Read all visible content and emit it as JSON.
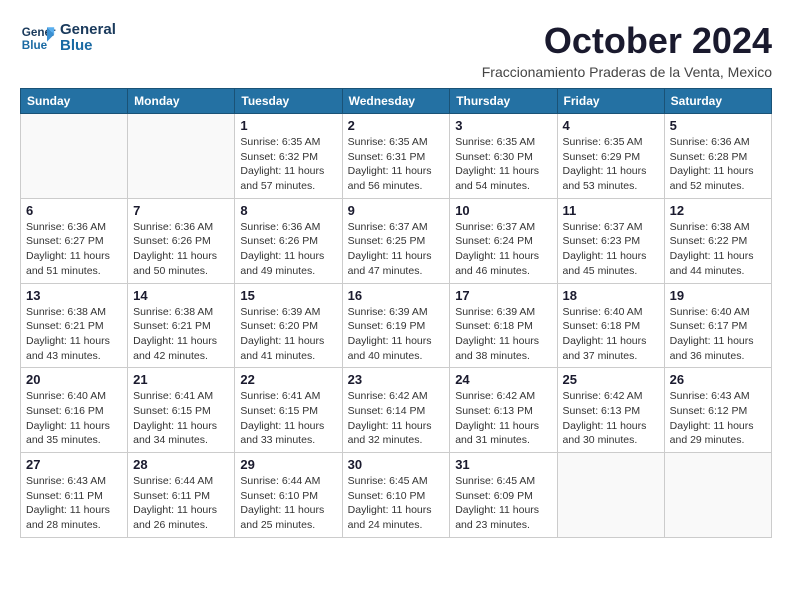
{
  "logo": {
    "line1": "General",
    "line2": "Blue"
  },
  "title": "October 2024",
  "subtitle": "Fraccionamiento Praderas de la Venta, Mexico",
  "weekdays": [
    "Sunday",
    "Monday",
    "Tuesday",
    "Wednesday",
    "Thursday",
    "Friday",
    "Saturday"
  ],
  "weeks": [
    [
      {
        "day": "",
        "info": ""
      },
      {
        "day": "",
        "info": ""
      },
      {
        "day": "1",
        "info": "Sunrise: 6:35 AM\nSunset: 6:32 PM\nDaylight: 11 hours\nand 57 minutes."
      },
      {
        "day": "2",
        "info": "Sunrise: 6:35 AM\nSunset: 6:31 PM\nDaylight: 11 hours\nand 56 minutes."
      },
      {
        "day": "3",
        "info": "Sunrise: 6:35 AM\nSunset: 6:30 PM\nDaylight: 11 hours\nand 54 minutes."
      },
      {
        "day": "4",
        "info": "Sunrise: 6:35 AM\nSunset: 6:29 PM\nDaylight: 11 hours\nand 53 minutes."
      },
      {
        "day": "5",
        "info": "Sunrise: 6:36 AM\nSunset: 6:28 PM\nDaylight: 11 hours\nand 52 minutes."
      }
    ],
    [
      {
        "day": "6",
        "info": "Sunrise: 6:36 AM\nSunset: 6:27 PM\nDaylight: 11 hours\nand 51 minutes."
      },
      {
        "day": "7",
        "info": "Sunrise: 6:36 AM\nSunset: 6:26 PM\nDaylight: 11 hours\nand 50 minutes."
      },
      {
        "day": "8",
        "info": "Sunrise: 6:36 AM\nSunset: 6:26 PM\nDaylight: 11 hours\nand 49 minutes."
      },
      {
        "day": "9",
        "info": "Sunrise: 6:37 AM\nSunset: 6:25 PM\nDaylight: 11 hours\nand 47 minutes."
      },
      {
        "day": "10",
        "info": "Sunrise: 6:37 AM\nSunset: 6:24 PM\nDaylight: 11 hours\nand 46 minutes."
      },
      {
        "day": "11",
        "info": "Sunrise: 6:37 AM\nSunset: 6:23 PM\nDaylight: 11 hours\nand 45 minutes."
      },
      {
        "day": "12",
        "info": "Sunrise: 6:38 AM\nSunset: 6:22 PM\nDaylight: 11 hours\nand 44 minutes."
      }
    ],
    [
      {
        "day": "13",
        "info": "Sunrise: 6:38 AM\nSunset: 6:21 PM\nDaylight: 11 hours\nand 43 minutes."
      },
      {
        "day": "14",
        "info": "Sunrise: 6:38 AM\nSunset: 6:21 PM\nDaylight: 11 hours\nand 42 minutes."
      },
      {
        "day": "15",
        "info": "Sunrise: 6:39 AM\nSunset: 6:20 PM\nDaylight: 11 hours\nand 41 minutes."
      },
      {
        "day": "16",
        "info": "Sunrise: 6:39 AM\nSunset: 6:19 PM\nDaylight: 11 hours\nand 40 minutes."
      },
      {
        "day": "17",
        "info": "Sunrise: 6:39 AM\nSunset: 6:18 PM\nDaylight: 11 hours\nand 38 minutes."
      },
      {
        "day": "18",
        "info": "Sunrise: 6:40 AM\nSunset: 6:18 PM\nDaylight: 11 hours\nand 37 minutes."
      },
      {
        "day": "19",
        "info": "Sunrise: 6:40 AM\nSunset: 6:17 PM\nDaylight: 11 hours\nand 36 minutes."
      }
    ],
    [
      {
        "day": "20",
        "info": "Sunrise: 6:40 AM\nSunset: 6:16 PM\nDaylight: 11 hours\nand 35 minutes."
      },
      {
        "day": "21",
        "info": "Sunrise: 6:41 AM\nSunset: 6:15 PM\nDaylight: 11 hours\nand 34 minutes."
      },
      {
        "day": "22",
        "info": "Sunrise: 6:41 AM\nSunset: 6:15 PM\nDaylight: 11 hours\nand 33 minutes."
      },
      {
        "day": "23",
        "info": "Sunrise: 6:42 AM\nSunset: 6:14 PM\nDaylight: 11 hours\nand 32 minutes."
      },
      {
        "day": "24",
        "info": "Sunrise: 6:42 AM\nSunset: 6:13 PM\nDaylight: 11 hours\nand 31 minutes."
      },
      {
        "day": "25",
        "info": "Sunrise: 6:42 AM\nSunset: 6:13 PM\nDaylight: 11 hours\nand 30 minutes."
      },
      {
        "day": "26",
        "info": "Sunrise: 6:43 AM\nSunset: 6:12 PM\nDaylight: 11 hours\nand 29 minutes."
      }
    ],
    [
      {
        "day": "27",
        "info": "Sunrise: 6:43 AM\nSunset: 6:11 PM\nDaylight: 11 hours\nand 28 minutes."
      },
      {
        "day": "28",
        "info": "Sunrise: 6:44 AM\nSunset: 6:11 PM\nDaylight: 11 hours\nand 26 minutes."
      },
      {
        "day": "29",
        "info": "Sunrise: 6:44 AM\nSunset: 6:10 PM\nDaylight: 11 hours\nand 25 minutes."
      },
      {
        "day": "30",
        "info": "Sunrise: 6:45 AM\nSunset: 6:10 PM\nDaylight: 11 hours\nand 24 minutes."
      },
      {
        "day": "31",
        "info": "Sunrise: 6:45 AM\nSunset: 6:09 PM\nDaylight: 11 hours\nand 23 minutes."
      },
      {
        "day": "",
        "info": ""
      },
      {
        "day": "",
        "info": ""
      }
    ]
  ]
}
